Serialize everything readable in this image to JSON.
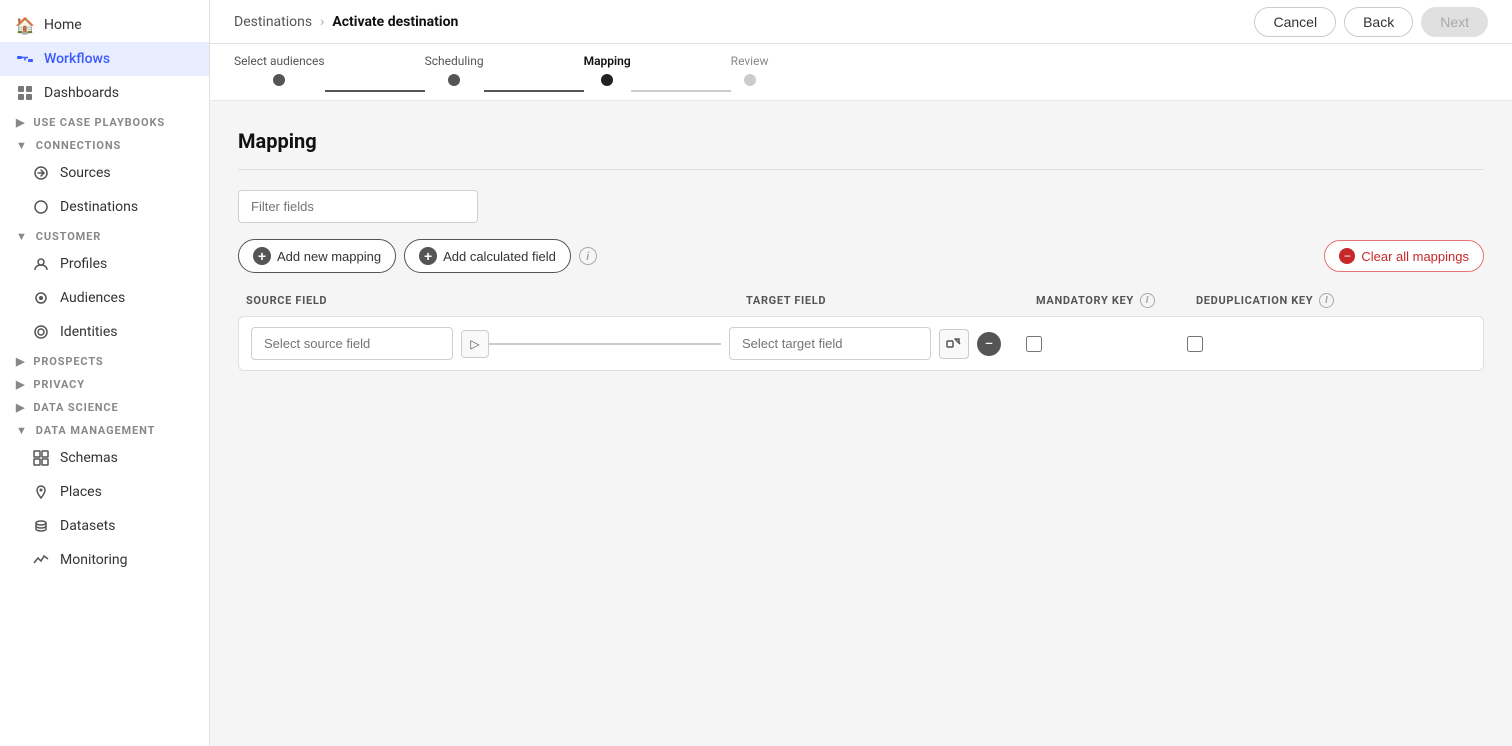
{
  "sidebar": {
    "items": [
      {
        "id": "home",
        "label": "Home",
        "icon": "🏠",
        "active": false
      },
      {
        "id": "workflows",
        "label": "Workflows",
        "icon": "⇄",
        "active": true
      },
      {
        "id": "dashboards",
        "label": "Dashboards",
        "icon": "📊",
        "active": false
      }
    ],
    "sections": [
      {
        "id": "use-case-playbooks",
        "label": "USE CASE PLAYBOOKS",
        "expanded": false
      },
      {
        "id": "connections",
        "label": "CONNECTIONS",
        "expanded": true,
        "children": [
          {
            "id": "sources",
            "label": "Sources",
            "icon": "←"
          },
          {
            "id": "destinations",
            "label": "Destinations",
            "icon": "○"
          }
        ]
      },
      {
        "id": "customer",
        "label": "CUSTOMER",
        "expanded": true,
        "children": [
          {
            "id": "profiles",
            "label": "Profiles",
            "icon": "👤"
          },
          {
            "id": "audiences",
            "label": "Audiences",
            "icon": "⊙"
          },
          {
            "id": "identities",
            "label": "Identities",
            "icon": "◉"
          }
        ]
      },
      {
        "id": "prospects",
        "label": "PROSPECTS",
        "expanded": false
      },
      {
        "id": "privacy",
        "label": "PRIVACY",
        "expanded": false
      },
      {
        "id": "data-science",
        "label": "DATA SCIENCE",
        "expanded": false
      },
      {
        "id": "data-management",
        "label": "DATA MANAGEMENT",
        "expanded": true,
        "children": [
          {
            "id": "schemas",
            "label": "Schemas",
            "icon": "⊞"
          },
          {
            "id": "places",
            "label": "Places",
            "icon": "📍"
          },
          {
            "id": "datasets",
            "label": "Datasets",
            "icon": "🗄"
          },
          {
            "id": "monitoring",
            "label": "Monitoring",
            "icon": "📈"
          }
        ]
      }
    ]
  },
  "topbar": {
    "breadcrumb_parent": "Destinations",
    "breadcrumb_separator": "›",
    "breadcrumb_current": "Activate destination",
    "cancel_label": "Cancel",
    "back_label": "Back",
    "next_label": "Next"
  },
  "stepper": {
    "steps": [
      {
        "id": "select-audiences",
        "label": "Select audiences",
        "state": "done"
      },
      {
        "id": "scheduling",
        "label": "Scheduling",
        "state": "done"
      },
      {
        "id": "mapping",
        "label": "Mapping",
        "state": "active"
      },
      {
        "id": "review",
        "label": "Review",
        "state": "pending"
      }
    ]
  },
  "mapping": {
    "title": "Mapping",
    "filter_placeholder": "Filter fields",
    "add_new_mapping_label": "Add new mapping",
    "add_calculated_field_label": "Add calculated field",
    "clear_all_label": "Clear all mappings",
    "source_field_header": "SOURCE FIELD",
    "target_field_header": "TARGET FIELD",
    "mandatory_key_header": "MANDATORY KEY",
    "deduplication_key_header": "DEDUPLICATION KEY",
    "row": {
      "source_placeholder": "Select source field",
      "target_placeholder": "Select target field"
    }
  }
}
